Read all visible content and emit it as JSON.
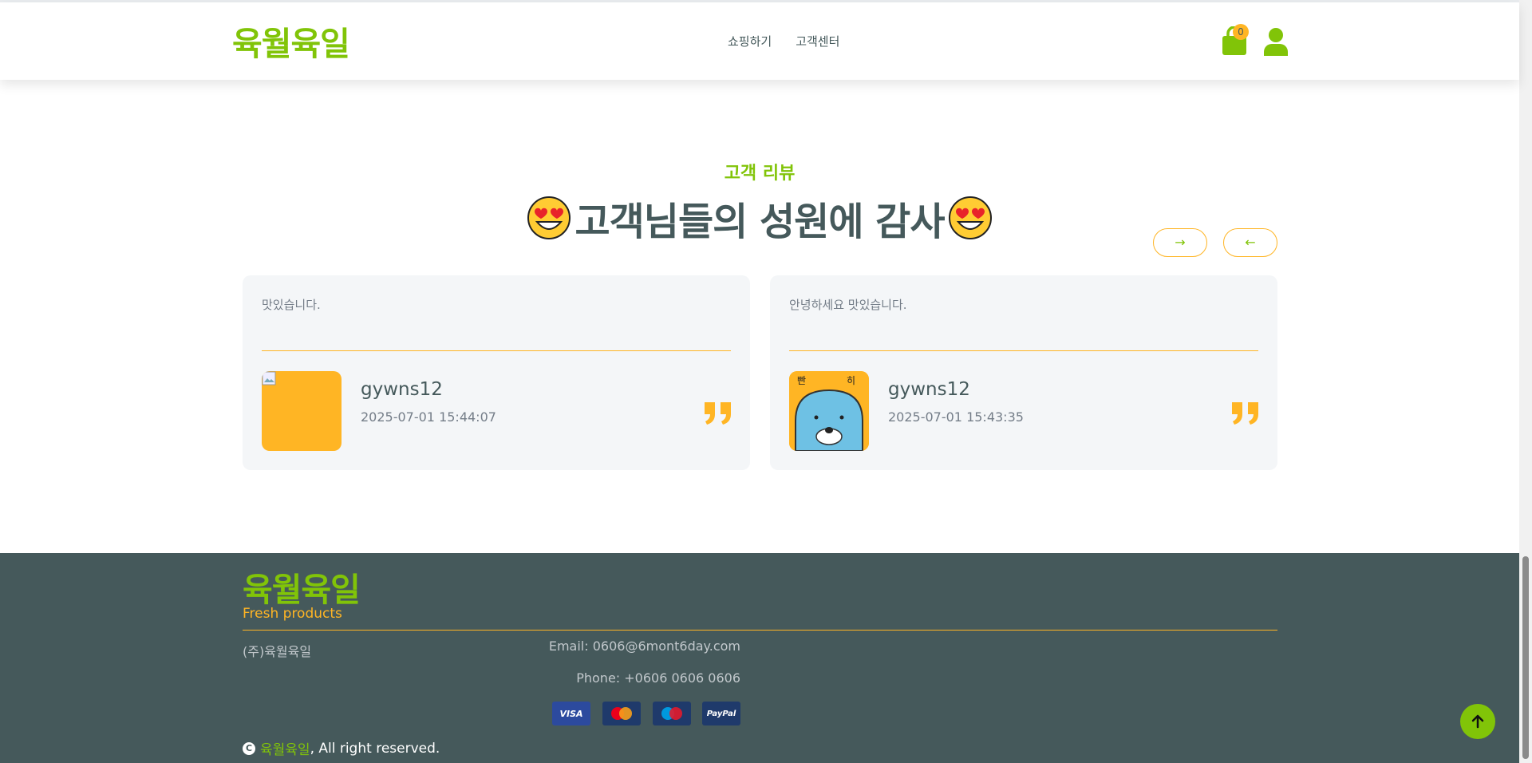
{
  "header": {
    "logo": "육월육일",
    "nav": [
      "쇼핑하기",
      "고객센터"
    ],
    "cart_count": "0",
    "colors": {
      "brand": "#81c408",
      "accent": "#ffb524",
      "text": "#45595b"
    }
  },
  "section": {
    "subtitle": "고객 리뷰",
    "title": "고객님들의 성원에 감사",
    "title_emoji": "heart-eyes-emoji",
    "next_icon": "→",
    "prev_icon": "←"
  },
  "reviews": [
    {
      "text": "맛있습니다.",
      "user": "gywns12",
      "date": "2025-07-01 15:44:07",
      "avatar": "broken-image"
    },
    {
      "text": "안녕하세요 맛있습니다.",
      "user": "gywns12",
      "date": "2025-07-01 15:43:35",
      "avatar": "seal-character"
    }
  ],
  "footer": {
    "logo": "육월육일",
    "tagline": "Fresh products",
    "company": "(주)육월육일",
    "email": "Email: 0606@6mont6day.com",
    "phone": "Phone: +0606 0606 0606",
    "payments": [
      "VISA",
      "MasterCard",
      "Maestro",
      "PayPal"
    ],
    "copyright_brand": "육월육일",
    "copyright_rest": ", All right reserved."
  }
}
